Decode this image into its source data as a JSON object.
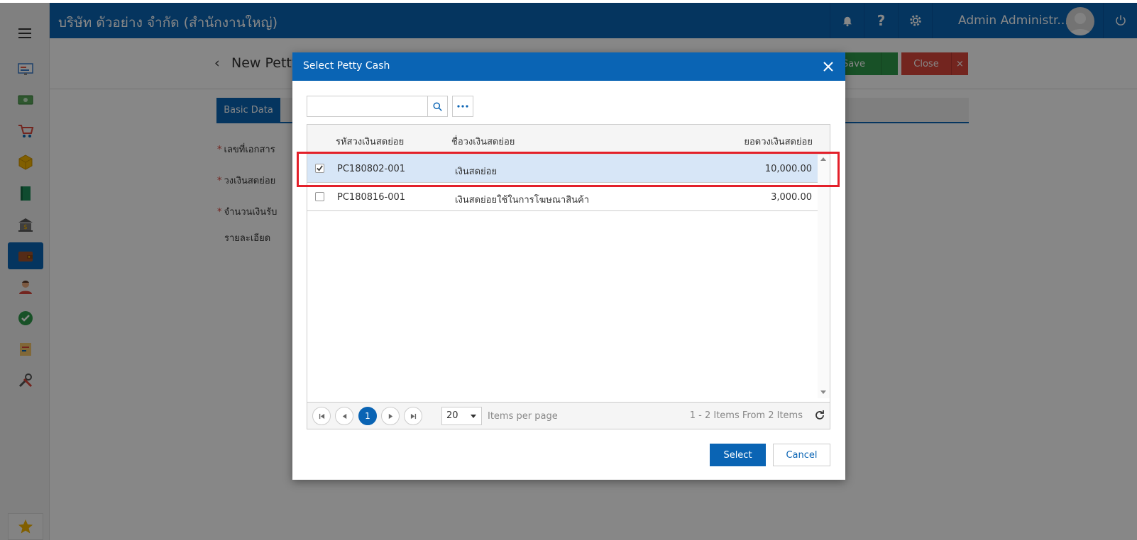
{
  "header": {
    "company": "บริษัท ตัวอย่าง จำกัด (สำนักงานใหญ่)",
    "user": "Admin Administr..."
  },
  "page": {
    "back_icon": "‹",
    "title": "New Petty",
    "save_label": "Save",
    "close_label": "Close",
    "close_x": "×",
    "tab_basic": "Basic Data",
    "fields": [
      {
        "label": "เลขที่เอกสาร",
        "required": "*"
      },
      {
        "label": "วงเงินสดย่อย",
        "required": "*"
      },
      {
        "label": "จำนวนเงินรับ",
        "required": "*"
      },
      {
        "label": "รายละเอียด",
        "required": ""
      }
    ]
  },
  "sidebar": {
    "items": [
      "dashboard-icon",
      "money-icon",
      "cart-icon",
      "box-icon",
      "book-icon",
      "bank-icon",
      "wallet-icon",
      "user-icon",
      "check-icon",
      "report-icon",
      "tools-icon"
    ],
    "active_index": 6
  },
  "modal": {
    "title": "Select Petty Cash",
    "search_placeholder": "",
    "columns": [
      "รหัสวงเงินสดย่อย",
      "ชื่อวงเงินสดย่อย",
      "ยอดวงเงินสดย่อย"
    ],
    "rows": [
      {
        "code": "PC180802-001",
        "name": "เงินสดย่อย",
        "amount": "10,000.00",
        "checked": true
      },
      {
        "code": "PC180816-001",
        "name": "เงินสดย่อยใช้ในการโฆษณาสินค้า",
        "amount": "3,000.00",
        "checked": false
      }
    ],
    "pager": {
      "current_page": "1",
      "page_size": "20",
      "items_per_page": "Items per page",
      "info": "1 - 2 Items From 2 Items"
    },
    "select_label": "Select",
    "cancel_label": "Cancel"
  },
  "colors": {
    "primary": "#0a64b4",
    "save": "#2e9a4a",
    "close": "#d9463b",
    "highlight": "#e3202a",
    "selected_row": "#d7e6f7"
  }
}
